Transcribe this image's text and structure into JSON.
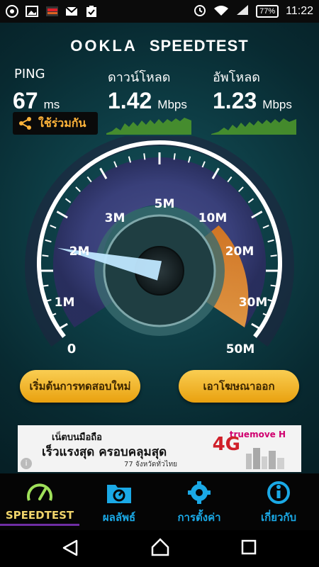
{
  "status_bar": {
    "battery": "77%",
    "time": "11:22"
  },
  "brand": {
    "name": "OOKLA",
    "product": "SPEEDTEST"
  },
  "stats": {
    "ping": {
      "label": "PING",
      "value": "67",
      "unit": "ms"
    },
    "download": {
      "label": "ดาวน์โหลด",
      "value": "1.42",
      "unit": "Mbps"
    },
    "upload": {
      "label": "อัพโหลด",
      "value": "1.23",
      "unit": "Mbps"
    }
  },
  "share": {
    "label": "ใช้ร่วมกัน"
  },
  "gauge": {
    "ticks": [
      "0",
      "1M",
      "2M",
      "3M",
      "5M",
      "10M",
      "20M",
      "30M",
      "50M"
    ],
    "needle_value_mbps": 1.42
  },
  "buttons": {
    "retest": "เริ่มต้นการทดสอบใหม่",
    "remove_ads": "เอาโฆษณาออก"
  },
  "ad": {
    "line1": "เน็ตบนมือถือ",
    "line2": "เร็วแรงสุด ครอบคลุมสุด",
    "line3": "77 จังหวัดทั่วไทย",
    "brand": "truemove H",
    "badge": "4G"
  },
  "tabs": [
    {
      "label": "SPEEDTEST",
      "icon": "speedometer-icon",
      "active": true
    },
    {
      "label": "ผลลัพธ์",
      "icon": "results-folder-icon",
      "active": false
    },
    {
      "label": "การตั้งค่า",
      "icon": "gear-icon",
      "active": false
    },
    {
      "label": "เกี่ยวกับ",
      "icon": "info-icon",
      "active": false
    }
  ],
  "colors": {
    "accent_orange": "#ffb43a",
    "tab_blue": "#1aa9e6",
    "pill_yellow": "#f1b42a",
    "active_tab": "#f0d46a"
  }
}
